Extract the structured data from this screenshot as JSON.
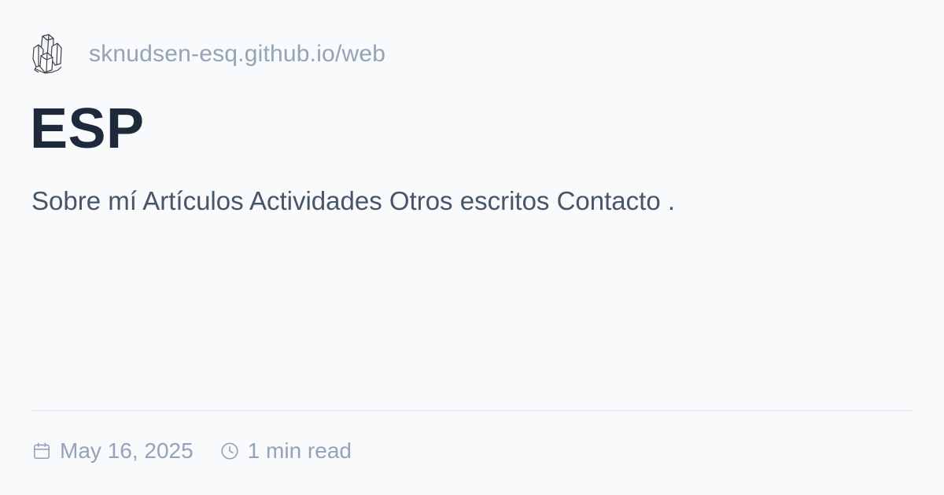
{
  "site": {
    "logo_icon": "crystal-logo-icon",
    "url": "sknudsen-esq.github.io/web"
  },
  "page": {
    "title": "ESP",
    "description": "Sobre mí Artículos Actividades Otros escritos Contacto ."
  },
  "meta": {
    "date_icon": "calendar-icon",
    "date": "May 16, 2025",
    "read_time_icon": "clock-icon",
    "read_time": "1 min read"
  },
  "colors": {
    "background": "#f8fafc",
    "title": "#1e293b",
    "description": "#475569",
    "muted": "#94a3b8",
    "divider": "#e2e8f0"
  }
}
